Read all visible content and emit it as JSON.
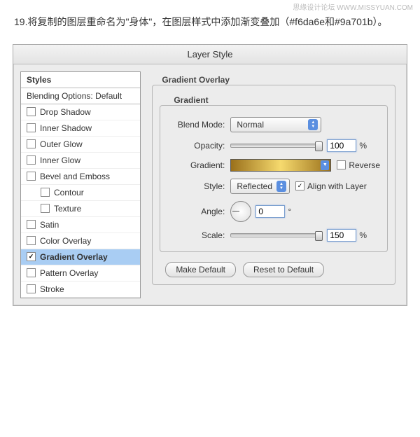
{
  "watermark": "思缘设计论坛  WWW.MISSYUAN.COM",
  "instruction": "19.将复制的图层重命名为\"身体\"，在图层样式中添加渐变叠加（#f6da6e和#9a701b）。",
  "dialog": {
    "title": "Layer Style",
    "styles_header": "Styles",
    "blending_options": "Blending Options: Default",
    "items": [
      {
        "label": "Drop Shadow",
        "checked": false,
        "sub": false
      },
      {
        "label": "Inner Shadow",
        "checked": false,
        "sub": false
      },
      {
        "label": "Outer Glow",
        "checked": false,
        "sub": false
      },
      {
        "label": "Inner Glow",
        "checked": false,
        "sub": false
      },
      {
        "label": "Bevel and Emboss",
        "checked": false,
        "sub": false
      },
      {
        "label": "Contour",
        "checked": false,
        "sub": true
      },
      {
        "label": "Texture",
        "checked": false,
        "sub": true
      },
      {
        "label": "Satin",
        "checked": false,
        "sub": false
      },
      {
        "label": "Color Overlay",
        "checked": false,
        "sub": false
      },
      {
        "label": "Gradient Overlay",
        "checked": true,
        "sub": false,
        "selected": true
      },
      {
        "label": "Pattern Overlay",
        "checked": false,
        "sub": false
      },
      {
        "label": "Stroke",
        "checked": false,
        "sub": false
      }
    ],
    "section": {
      "title": "Gradient Overlay",
      "subtitle": "Gradient",
      "blend_mode_label": "Blend Mode:",
      "blend_mode_value": "Normal",
      "opacity_label": "Opacity:",
      "opacity_value": "100",
      "opacity_unit": "%",
      "gradient_label": "Gradient:",
      "reverse_label": "Reverse",
      "reverse_checked": false,
      "style_label": "Style:",
      "style_value": "Reflected",
      "align_label": "Align with Layer",
      "align_checked": true,
      "angle_label": "Angle:",
      "angle_value": "0",
      "angle_unit": "°",
      "scale_label": "Scale:",
      "scale_value": "150",
      "scale_unit": "%",
      "gradient_colors": [
        "#f6da6e",
        "#9a701b"
      ]
    },
    "buttons": {
      "make_default": "Make Default",
      "reset": "Reset to Default"
    }
  }
}
